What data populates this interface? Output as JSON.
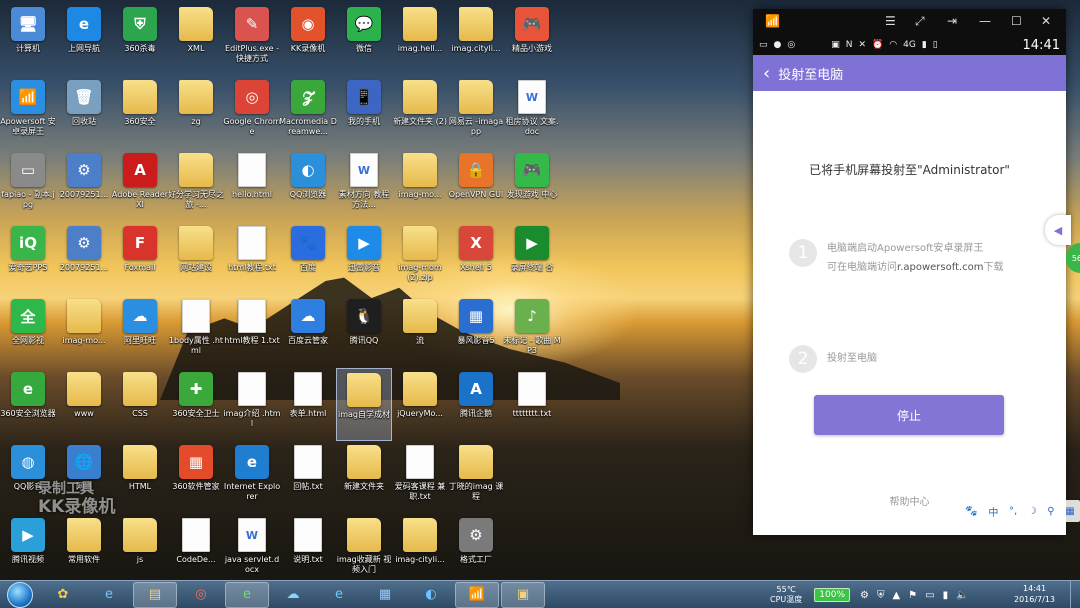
{
  "desktop": {
    "icons": [
      {
        "label": "计算机",
        "glyph": "🖥",
        "color": "#4a8ad6",
        "kind": "app"
      },
      {
        "label": "上网导航",
        "glyph": "e",
        "color": "#1e88e5",
        "kind": "app"
      },
      {
        "label": "360杀毒",
        "glyph": "⛨",
        "color": "#2da44e",
        "kind": "app"
      },
      {
        "label": "XML",
        "glyph": "",
        "color": "",
        "kind": "folder"
      },
      {
        "label": "EditPlus.exe - 快捷方式",
        "glyph": "✎",
        "color": "#d9534f",
        "kind": "app"
      },
      {
        "label": "KK录像机",
        "glyph": "◉",
        "color": "#e2522b",
        "kind": "app"
      },
      {
        "label": "微信",
        "glyph": "💬",
        "color": "#2bb24c",
        "kind": "app"
      },
      {
        "label": "imag.hell...",
        "glyph": "",
        "color": "",
        "kind": "folder"
      },
      {
        "label": "imag.cityli...",
        "glyph": "",
        "color": "",
        "kind": "folder"
      },
      {
        "label": "精品小游戏",
        "glyph": "🎮",
        "color": "#e8543a",
        "kind": "app"
      },
      {
        "label": "Apowersoft 安卓录屏王",
        "glyph": "📶",
        "color": "#2a8fe0",
        "kind": "app"
      },
      {
        "label": "回收站",
        "glyph": "🗑",
        "color": "#7aa0c0",
        "kind": "app"
      },
      {
        "label": "360安全",
        "glyph": "",
        "color": "",
        "kind": "folder"
      },
      {
        "label": "zg",
        "glyph": "",
        "color": "",
        "kind": "folder"
      },
      {
        "label": "Google Chrome",
        "glyph": "◎",
        "color": "#db4437",
        "kind": "app"
      },
      {
        "label": "Macromedia Dreamwe...",
        "glyph": "𝓩",
        "color": "#3aa73a",
        "kind": "app"
      },
      {
        "label": "我的手机",
        "glyph": "📱",
        "color": "#3d66c4",
        "kind": "app"
      },
      {
        "label": "新建文件夹 (2)",
        "glyph": "",
        "color": "",
        "kind": "folder"
      },
      {
        "label": "网易云 -imagapp",
        "glyph": "",
        "color": "",
        "kind": "folder"
      },
      {
        "label": "租房协议 文案.doc",
        "glyph": "W",
        "color": "",
        "kind": "doc"
      },
      {
        "label": "fapiao - 副本.jpg",
        "glyph": "▭",
        "color": "#8a8a8a",
        "kind": "app"
      },
      {
        "label": "20079251...",
        "glyph": "⚙",
        "color": "#4d7fc9",
        "kind": "app"
      },
      {
        "label": "Adobe Reader XI",
        "glyph": "A",
        "color": "#cc1b1b",
        "kind": "app"
      },
      {
        "label": "好分学习无尽之旅 -...",
        "glyph": "",
        "color": "",
        "kind": "folder"
      },
      {
        "label": "hello.html",
        "glyph": "",
        "color": "",
        "kind": "doc"
      },
      {
        "label": "QQ浏览器",
        "glyph": "◐",
        "color": "#2b8fd9",
        "kind": "app"
      },
      {
        "label": "素材方向 教程方法...",
        "glyph": "W",
        "color": "",
        "kind": "doc"
      },
      {
        "label": "imag-mo...",
        "glyph": "",
        "color": "",
        "kind": "folder"
      },
      {
        "label": "OpenVPN GUI",
        "glyph": "🔒",
        "color": "#e8742a",
        "kind": "app"
      },
      {
        "label": "发现游戏 中心",
        "glyph": "🎮",
        "color": "#35b94a",
        "kind": "app"
      },
      {
        "label": "爱奇艺PPS",
        "glyph": "iQ",
        "color": "#39b54a",
        "kind": "app"
      },
      {
        "label": "20079251...",
        "glyph": "⚙",
        "color": "#4d7fc9",
        "kind": "app"
      },
      {
        "label": "Foxmail",
        "glyph": "F",
        "color": "#d9342b",
        "kind": "app"
      },
      {
        "label": "网站建设",
        "glyph": "",
        "color": "",
        "kind": "folder"
      },
      {
        "label": "html教程.txt",
        "glyph": "",
        "color": "",
        "kind": "doc"
      },
      {
        "label": "百度",
        "glyph": "🐾",
        "color": "#2b6de0",
        "kind": "app"
      },
      {
        "label": "迅雷影音",
        "glyph": "▶",
        "color": "#1f8be8",
        "kind": "app"
      },
      {
        "label": "imag-mom (2).zip",
        "glyph": "",
        "color": "",
        "kind": "folder"
      },
      {
        "label": "Xshell 5",
        "glyph": "X",
        "color": "#d9463a",
        "kind": "app"
      },
      {
        "label": "录屏终端 合",
        "glyph": "▶",
        "color": "#1a8c2e",
        "kind": "app"
      },
      {
        "label": "全网影视",
        "glyph": "全",
        "color": "#2fb84a",
        "kind": "app"
      },
      {
        "label": "imag-mo...",
        "glyph": "",
        "color": "",
        "kind": "folder"
      },
      {
        "label": "阿里旺旺",
        "glyph": "☁",
        "color": "#2a8fe0",
        "kind": "app"
      },
      {
        "label": "1body属性 .html",
        "glyph": "",
        "color": "",
        "kind": "doc"
      },
      {
        "label": "html教程 1.txt",
        "glyph": "",
        "color": "",
        "kind": "doc"
      },
      {
        "label": "百度云管家",
        "glyph": "☁",
        "color": "#2f7fe0",
        "kind": "app"
      },
      {
        "label": "腾讯QQ",
        "glyph": "🐧",
        "color": "#1f1f1f",
        "kind": "app"
      },
      {
        "label": "流",
        "glyph": "",
        "color": "",
        "kind": "folder"
      },
      {
        "label": "暴风影音5",
        "glyph": "▦",
        "color": "#2a6fd0",
        "kind": "app"
      },
      {
        "label": "未标记 - 歌曲 MP3",
        "glyph": "♪",
        "color": "#6ab04c",
        "kind": "app"
      },
      {
        "label": "360安全浏览器",
        "glyph": "e",
        "color": "#35a83e",
        "kind": "app"
      },
      {
        "label": "www",
        "glyph": "",
        "color": "",
        "kind": "folder"
      },
      {
        "label": "CSS",
        "glyph": "",
        "color": "",
        "kind": "folder"
      },
      {
        "label": "360安全卫士",
        "glyph": "✚",
        "color": "#3aa83a",
        "kind": "app"
      },
      {
        "label": "imag介绍 .html",
        "glyph": "",
        "color": "",
        "kind": "doc"
      },
      {
        "label": "表单.html",
        "glyph": "",
        "color": "",
        "kind": "doc"
      },
      {
        "label": "imag自学成材",
        "glyph": "",
        "color": "",
        "kind": "folder"
      },
      {
        "label": "jQueryMo...",
        "glyph": "",
        "color": "",
        "kind": "folder"
      },
      {
        "label": "腾讯企鹅",
        "glyph": "A",
        "color": "#1a73c9",
        "kind": "app"
      },
      {
        "label": "tttttttt.txt",
        "glyph": "",
        "color": "",
        "kind": "doc"
      },
      {
        "label": "QQ影音",
        "glyph": "◍",
        "color": "#2b8fd9",
        "kind": "app"
      },
      {
        "label": "网络",
        "glyph": "🌐",
        "color": "#3a7fcf",
        "kind": "app"
      },
      {
        "label": "HTML",
        "glyph": "",
        "color": "",
        "kind": "folder"
      },
      {
        "label": "360软件管家",
        "glyph": "▦",
        "color": "#e34b2a",
        "kind": "app"
      },
      {
        "label": "Internet Explorer",
        "glyph": "e",
        "color": "#1f7ed0",
        "kind": "app"
      },
      {
        "label": "回帖.txt",
        "glyph": "",
        "color": "",
        "kind": "doc"
      },
      {
        "label": "新建文件夹",
        "glyph": "",
        "color": "",
        "kind": "folder"
      },
      {
        "label": "爱码客课程 兼职.txt",
        "glyph": "",
        "color": "",
        "kind": "doc"
      },
      {
        "label": "丁晓的imag 课程",
        "glyph": "",
        "color": "",
        "kind": "folder"
      },
      {
        "label": "",
        "glyph": "",
        "color": "",
        "kind": "empty"
      },
      {
        "label": "腾讯视频",
        "glyph": "▶",
        "color": "#2a9fd8",
        "kind": "app"
      },
      {
        "label": "常用软件",
        "glyph": "",
        "color": "",
        "kind": "folder"
      },
      {
        "label": "js",
        "glyph": "",
        "color": "",
        "kind": "folder"
      },
      {
        "label": "CodeDe...",
        "glyph": "",
        "color": "",
        "kind": "doc"
      },
      {
        "label": "java servlet.docx",
        "glyph": "W",
        "color": "",
        "kind": "doc"
      },
      {
        "label": "说明.txt",
        "glyph": "",
        "color": "",
        "kind": "doc"
      },
      {
        "label": "imag收藏新 视频入门",
        "glyph": "",
        "color": "",
        "kind": "folder"
      },
      {
        "label": "imag-cityli...",
        "glyph": "",
        "color": "",
        "kind": "folder"
      },
      {
        "label": "格式工厂",
        "glyph": "⚙",
        "color": "#7a7a7a",
        "kind": "app"
      },
      {
        "label": "",
        "glyph": "",
        "color": "",
        "kind": "empty"
      }
    ],
    "selected_label": "imag自学成材",
    "watermark_line1": "录制工具",
    "watermark_line2": "KK录像机"
  },
  "phone": {
    "status_time": "14:41",
    "network": "4G",
    "appbar_title": "投射至电脑",
    "message": "已将手机屏幕投射至\"Administrator\"",
    "steps": [
      {
        "num": "1",
        "line1": "电脑端启动Apowersoft安卓录屏王",
        "line2_prefix": "可在电脑端访问",
        "line2_link": "r.apowersoft.com",
        "line2_suffix": "下载"
      },
      {
        "num": "2",
        "line1": "投射至电脑"
      }
    ],
    "stop_button": "停止",
    "help_link": "帮助中心",
    "side_badge": "56",
    "ime": {
      "lang": "中"
    }
  },
  "taskbar": {
    "temperature": "55℃",
    "temp_label": "CPU温度",
    "battery": "100%",
    "clock_time": "14:41",
    "clock_date": "2016/7/13"
  },
  "colors": {
    "accent": "#7e72d6",
    "taskbar": "#3a5876"
  }
}
